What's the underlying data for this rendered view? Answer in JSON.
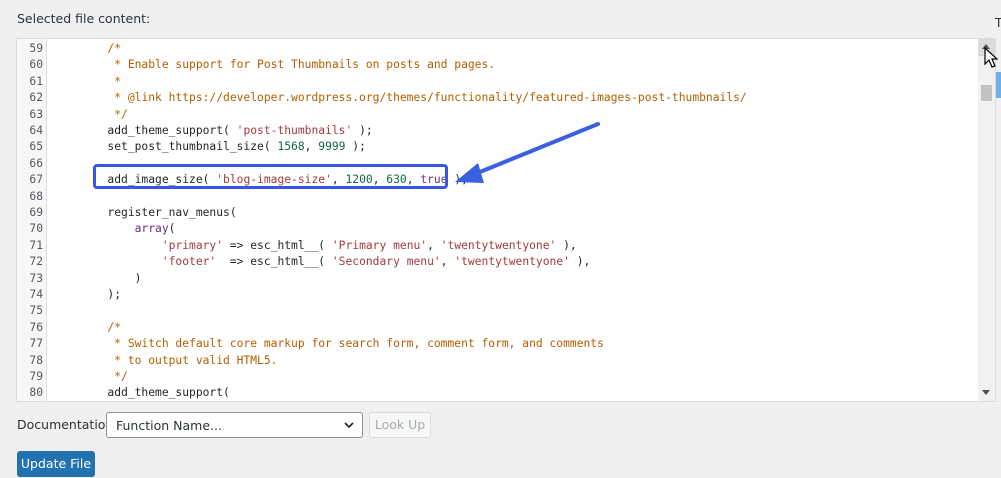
{
  "heading": "Selected file content:",
  "edge_letter": "T",
  "editor": {
    "lines": [
      {
        "n": "59",
        "tokens": [
          {
            "t": "        /*",
            "c": "comment"
          }
        ]
      },
      {
        "n": "60",
        "tokens": [
          {
            "t": "         * Enable support for Post Thumbnails on posts and pages.",
            "c": "comment"
          }
        ]
      },
      {
        "n": "61",
        "tokens": [
          {
            "t": "         *",
            "c": "comment"
          }
        ]
      },
      {
        "n": "62",
        "tokens": [
          {
            "t": "         * @link https://developer.wordpress.org/themes/functionality/featured-images-post-thumbnails/",
            "c": "comment"
          }
        ]
      },
      {
        "n": "63",
        "tokens": [
          {
            "t": "         */",
            "c": "comment"
          }
        ]
      },
      {
        "n": "64",
        "tokens": [
          {
            "t": "        add_theme_support( ",
            "c": "plain"
          },
          {
            "t": "'post-thumbnails'",
            "c": "string"
          },
          {
            "t": " );",
            "c": "plain"
          }
        ]
      },
      {
        "n": "65",
        "tokens": [
          {
            "t": "        set_post_thumbnail_size( ",
            "c": "plain"
          },
          {
            "t": "1568",
            "c": "number"
          },
          {
            "t": ", ",
            "c": "plain"
          },
          {
            "t": "9999",
            "c": "number"
          },
          {
            "t": " );",
            "c": "plain"
          }
        ]
      },
      {
        "n": "66",
        "tokens": []
      },
      {
        "n": "67",
        "tokens": [
          {
            "t": "        add_image_size( ",
            "c": "plain"
          },
          {
            "t": "'blog-image-size'",
            "c": "string"
          },
          {
            "t": ", ",
            "c": "plain"
          },
          {
            "t": "1200",
            "c": "number"
          },
          {
            "t": ", ",
            "c": "plain"
          },
          {
            "t": "630",
            "c": "number"
          },
          {
            "t": ", ",
            "c": "plain"
          },
          {
            "t": "true",
            "c": "keyword"
          },
          {
            "t": " );",
            "c": "plain"
          }
        ]
      },
      {
        "n": "68",
        "tokens": []
      },
      {
        "n": "69",
        "tokens": [
          {
            "t": "        register_nav_menus(",
            "c": "plain"
          }
        ]
      },
      {
        "n": "70",
        "tokens": [
          {
            "t": "            ",
            "c": "plain"
          },
          {
            "t": "array",
            "c": "keyword"
          },
          {
            "t": "(",
            "c": "plain"
          }
        ]
      },
      {
        "n": "71",
        "tokens": [
          {
            "t": "                ",
            "c": "plain"
          },
          {
            "t": "'primary'",
            "c": "string"
          },
          {
            "t": " => esc_html__( ",
            "c": "plain"
          },
          {
            "t": "'Primary menu'",
            "c": "string"
          },
          {
            "t": ", ",
            "c": "plain"
          },
          {
            "t": "'twentytwentyone'",
            "c": "string"
          },
          {
            "t": " ),",
            "c": "plain"
          }
        ]
      },
      {
        "n": "72",
        "tokens": [
          {
            "t": "                ",
            "c": "plain"
          },
          {
            "t": "'footer'",
            "c": "string"
          },
          {
            "t": "  => esc_html__( ",
            "c": "plain"
          },
          {
            "t": "'Secondary menu'",
            "c": "string"
          },
          {
            "t": ", ",
            "c": "plain"
          },
          {
            "t": "'twentytwentyone'",
            "c": "string"
          },
          {
            "t": " ),",
            "c": "plain"
          }
        ]
      },
      {
        "n": "73",
        "tokens": [
          {
            "t": "            )",
            "c": "plain"
          }
        ]
      },
      {
        "n": "74",
        "tokens": [
          {
            "t": "        );",
            "c": "plain"
          }
        ]
      },
      {
        "n": "75",
        "tokens": []
      },
      {
        "n": "76",
        "tokens": [
          {
            "t": "        /*",
            "c": "comment"
          }
        ]
      },
      {
        "n": "77",
        "tokens": [
          {
            "t": "         * Switch default core markup for search form, comment form, and comments",
            "c": "comment"
          }
        ]
      },
      {
        "n": "78",
        "tokens": [
          {
            "t": "         * to output valid HTML5.",
            "c": "comment"
          }
        ]
      },
      {
        "n": "79",
        "tokens": [
          {
            "t": "         */",
            "c": "comment"
          }
        ]
      },
      {
        "n": "80",
        "tokens": [
          {
            "t": "        add_theme_support(",
            "c": "plain"
          }
        ]
      }
    ]
  },
  "highlight": {
    "color": "#3856e0"
  },
  "cursor_icon": "mouse-pointer-icon",
  "documentation": {
    "label": "Documentation:",
    "selected": "Function Name...",
    "lookup_label": "Look Up"
  },
  "update_label": "Update File",
  "colors": {
    "primary_button": "#2271b1",
    "arrow": "#3a5fe0"
  }
}
